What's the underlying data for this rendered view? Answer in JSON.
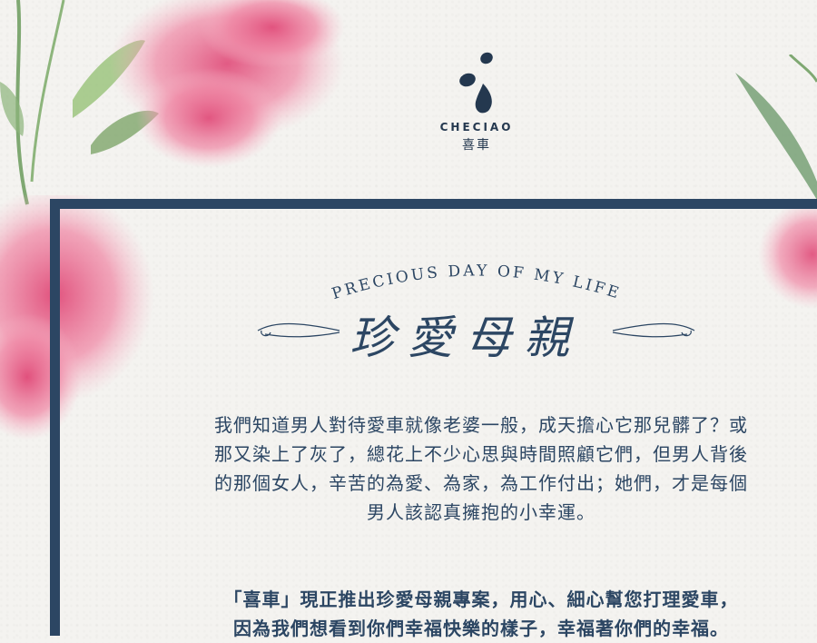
{
  "brand": {
    "name_en": "CHECIAO",
    "name_cn": "喜車"
  },
  "hero": {
    "subtitle": "PRECIOUS DAY OF MY LIFE",
    "title": "珍愛母親"
  },
  "intro": [
    "我們知道男人對待愛車就像老婆一般，成天擔心它那兒髒了？或",
    "那又染上了灰了，總花上不少心思與時間照顧它們，但男人背後",
    "的那個女人，辛苦的為愛、為家，為工作付出；她們，才是每個",
    "男人該認真擁抱的小幸運。"
  ],
  "highlight": [
    "「喜車」現正推出珍愛母親專案，用心、細心幫您打理愛車，",
    "因為我們想看到你們幸福快樂的樣子，幸福著你們的幸福。"
  ],
  "colors": {
    "accent": "#2c4663",
    "flower": "#e6698f",
    "leaf": "#7fae6a",
    "background": "#f4f3f0"
  }
}
